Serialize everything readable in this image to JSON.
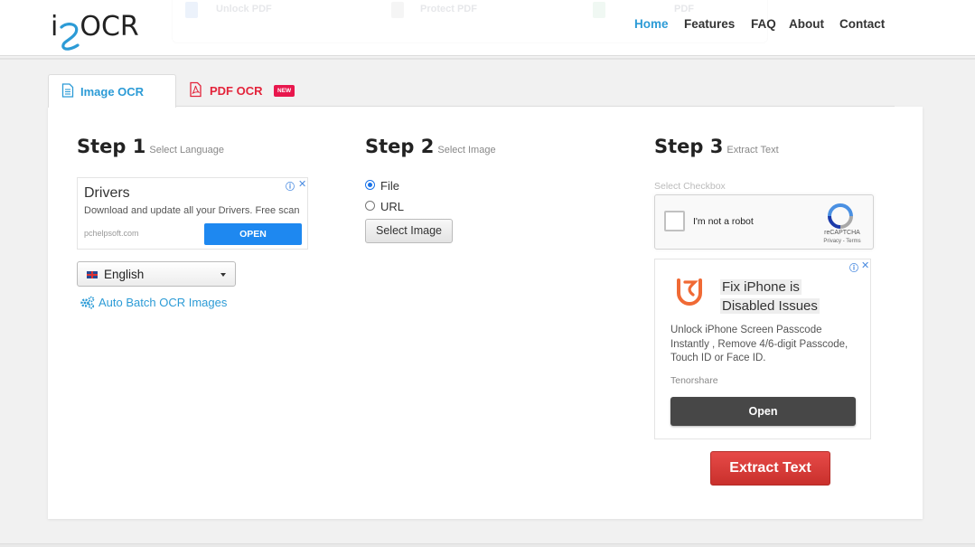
{
  "header": {
    "logo_text": "i2OCR",
    "ghost_menu": [
      "Unlock PDF",
      "Protect PDF",
      "PDF"
    ],
    "nav": [
      "Home",
      "Features",
      "FAQ",
      "About",
      "Contact"
    ],
    "active_nav": "Home"
  },
  "tabs": [
    {
      "label": "Image OCR",
      "icon": "image-document-icon",
      "active": true
    },
    {
      "label": "PDF OCR",
      "icon": "pdf-icon",
      "badge": "NEW",
      "active": false
    }
  ],
  "step1": {
    "title": "Step 1",
    "subtitle": "Select Language",
    "ad": {
      "title": "Drivers",
      "desc": "Download and update all your Drivers. Free scan",
      "url": "pchelpsoft.com",
      "button": "OPEN"
    },
    "language": {
      "selected": "English",
      "flag": "uk-flag-icon"
    },
    "batch_link": "Auto Batch OCR Images"
  },
  "step2": {
    "title": "Step 2",
    "subtitle": "Select Image",
    "options": [
      {
        "label": "File",
        "selected": true
      },
      {
        "label": "URL",
        "selected": false
      }
    ],
    "button": "Select Image"
  },
  "step3": {
    "title": "Step 3",
    "subtitle": "Extract Text",
    "checkbox_hint": "Select Checkbox",
    "recaptcha": {
      "label": "I'm not a robot",
      "brand": "reCAPTCHA",
      "terms": "Privacy - Terms"
    },
    "ad": {
      "headline_1": "Fix iPhone is",
      "headline_2": "Disabled Issues",
      "body": "Unlock iPhone Screen Passcode Instantly , Remove 4/6-digit Passcode, Touch ID or Face ID.",
      "sponsor": "Tenorshare",
      "button": "Open"
    },
    "extract_button": "Extract Text"
  },
  "colors": {
    "accent": "#2c9bd6",
    "pdf": "#e3243b",
    "extract": "#d9534f",
    "ad_button": "#1e88f0"
  }
}
